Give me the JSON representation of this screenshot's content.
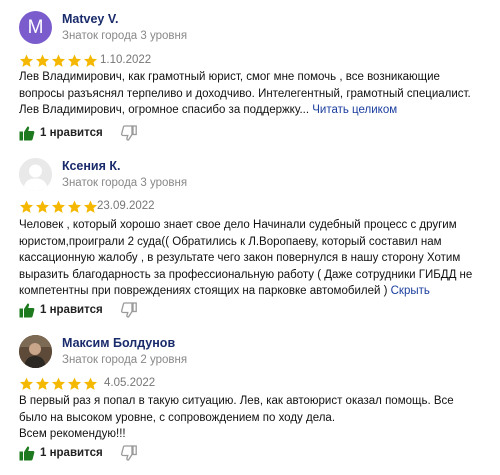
{
  "reviews": [
    {
      "author": "Matvey V.",
      "avatar_letter": "M",
      "level": "Знаток города 3 уровня",
      "rating": 5,
      "date": "1.10.2022",
      "text": "Лев Владимирович, как грамотный юрист, смог мне помочь , все возникающие вопросы разъяснял терпеливо и доходчиво. Интелегентный, грамотный специалист. Лев Владимирович, огромное спасибо за поддержку...",
      "more": "Читать целиком",
      "likes": "1 нравится"
    },
    {
      "author": "Ксения К.",
      "level": "Знаток города 3 уровня",
      "rating": 5,
      "date": "23.09.2022",
      "text": "Человек , который хорошо знает свое дело Начинали судебный процесс с другим юристом,проиграли 2 суда(( Обратились к Л.Воропаеву, который составил нам кассационную жалобу , в результате чего закон повернулся в нашу сторону  Хотим выразить благодарность за профессиональную работу  ( Даже сотрудники ГИБДД не компетентны при повреждениях стоящих на парковке автомобилей )",
      "more": "Скрыть",
      "likes": "1 нравится"
    },
    {
      "author": "Максим Болдунов",
      "level": "Знаток города 2 уровня",
      "rating": 5,
      "date": "4.05.2022",
      "text_lines": [
        "В первый раз я попал в такую ситуацию. Лев, как автоюрист оказал помощь. Все было на высоком уровне, с сопровождением по ходу дела.",
        "Всем рекомендую!!!"
      ],
      "likes": "1 нравится"
    }
  ],
  "colors": {
    "star": "#f5b800",
    "like": "#1e7a1e",
    "dislike": "#9a9a9a",
    "link": "#1a3d9e",
    "author": "#1a2b6b"
  },
  "icons": {
    "like": "thumbs-up-icon",
    "dislike": "thumbs-down-icon",
    "star": "star-icon"
  }
}
